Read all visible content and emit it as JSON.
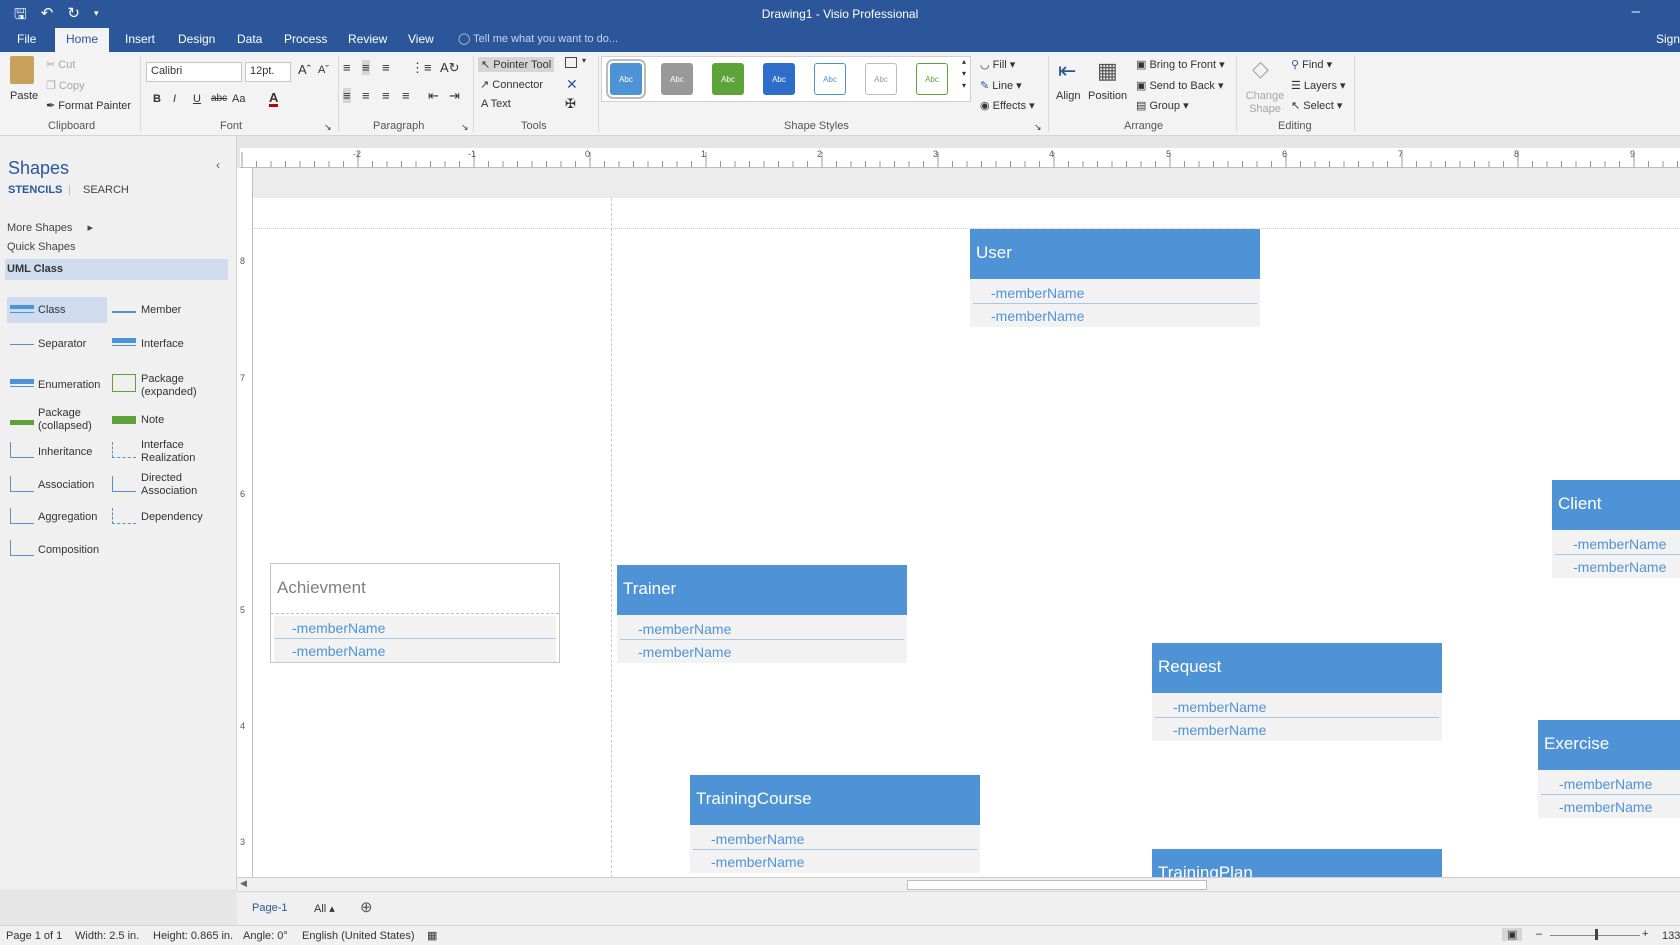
{
  "titlebar": {
    "title": "Drawing1 - Visio Professional"
  },
  "tabs": {
    "file": "File",
    "home": "Home",
    "insert": "Insert",
    "design": "Design",
    "data": "Data",
    "process": "Process",
    "review": "Review",
    "view": "View",
    "tell_me": "Tell me what you want to do...",
    "sign_in": "Sign"
  },
  "ribbon": {
    "clipboard": {
      "paste": "Paste",
      "cut": "Cut",
      "copy": "Copy",
      "format_painter": "Format Painter",
      "label": "Clipboard"
    },
    "font": {
      "name": "Calibri",
      "size": "12pt.",
      "bold": "B",
      "italic": "I",
      "underline": "U",
      "strike": "abc",
      "case": "Aa",
      "color": "A",
      "label": "Font"
    },
    "paragraph": {
      "label": "Paragraph"
    },
    "tools": {
      "pointer": "Pointer Tool",
      "connector": "Connector",
      "text": "Text",
      "label": "Tools"
    },
    "shape_styles": {
      "swatch_text": "Abc",
      "label": "Shape Styles",
      "fill": "Fill",
      "line": "Line",
      "effects": "Effects"
    },
    "arrange": {
      "align": "Align",
      "position": "Position",
      "bring_front": "Bring to Front",
      "send_back": "Send to Back",
      "group": "Group",
      "label": "Arrange"
    },
    "editing": {
      "change_shape": "Change Shape",
      "find": "Find",
      "layers": "Layers",
      "select": "Select",
      "label": "Editing"
    }
  },
  "shapes_panel": {
    "title": "Shapes",
    "tab_stencils": "STENCILS",
    "tab_search": "SEARCH",
    "more_shapes": "More Shapes",
    "quick_shapes": "Quick Shapes",
    "uml_class": "UML Class",
    "masters": [
      "Class",
      "Member",
      "Separator",
      "Interface",
      "Enumeration",
      "Package (expanded)",
      "Package (collapsed)",
      "Note",
      "Inheritance",
      "Interface Realization",
      "Association",
      "Directed Association",
      "Aggregation",
      "Dependency",
      "Composition"
    ]
  },
  "ruler": {
    "top_ticks": [
      "-2",
      "-1",
      "0",
      "1",
      "2",
      "3",
      "4",
      "5",
      "6",
      "7",
      "8",
      "9"
    ],
    "left_ticks": [
      "8",
      "7",
      "6",
      "5",
      "4",
      "3"
    ]
  },
  "diagram": {
    "member": "-memberName",
    "classes": [
      "User",
      "Client",
      "Achievment",
      "Trainer",
      "Request",
      "Exercise",
      "TrainingCourse",
      "TrainingPlan"
    ]
  },
  "pages": {
    "active": "Page-1",
    "all": "All"
  },
  "status": {
    "page": "Page 1 of 1",
    "width": "Width: 2.5 in.",
    "height": "Height: 0.865 in.",
    "angle": "Angle: 0°",
    "language": "English (United States)",
    "zoom": "133"
  },
  "colors": {
    "brand": "#2b579a",
    "class_header": "#4f93d7",
    "member_text": "#4f93d7"
  }
}
